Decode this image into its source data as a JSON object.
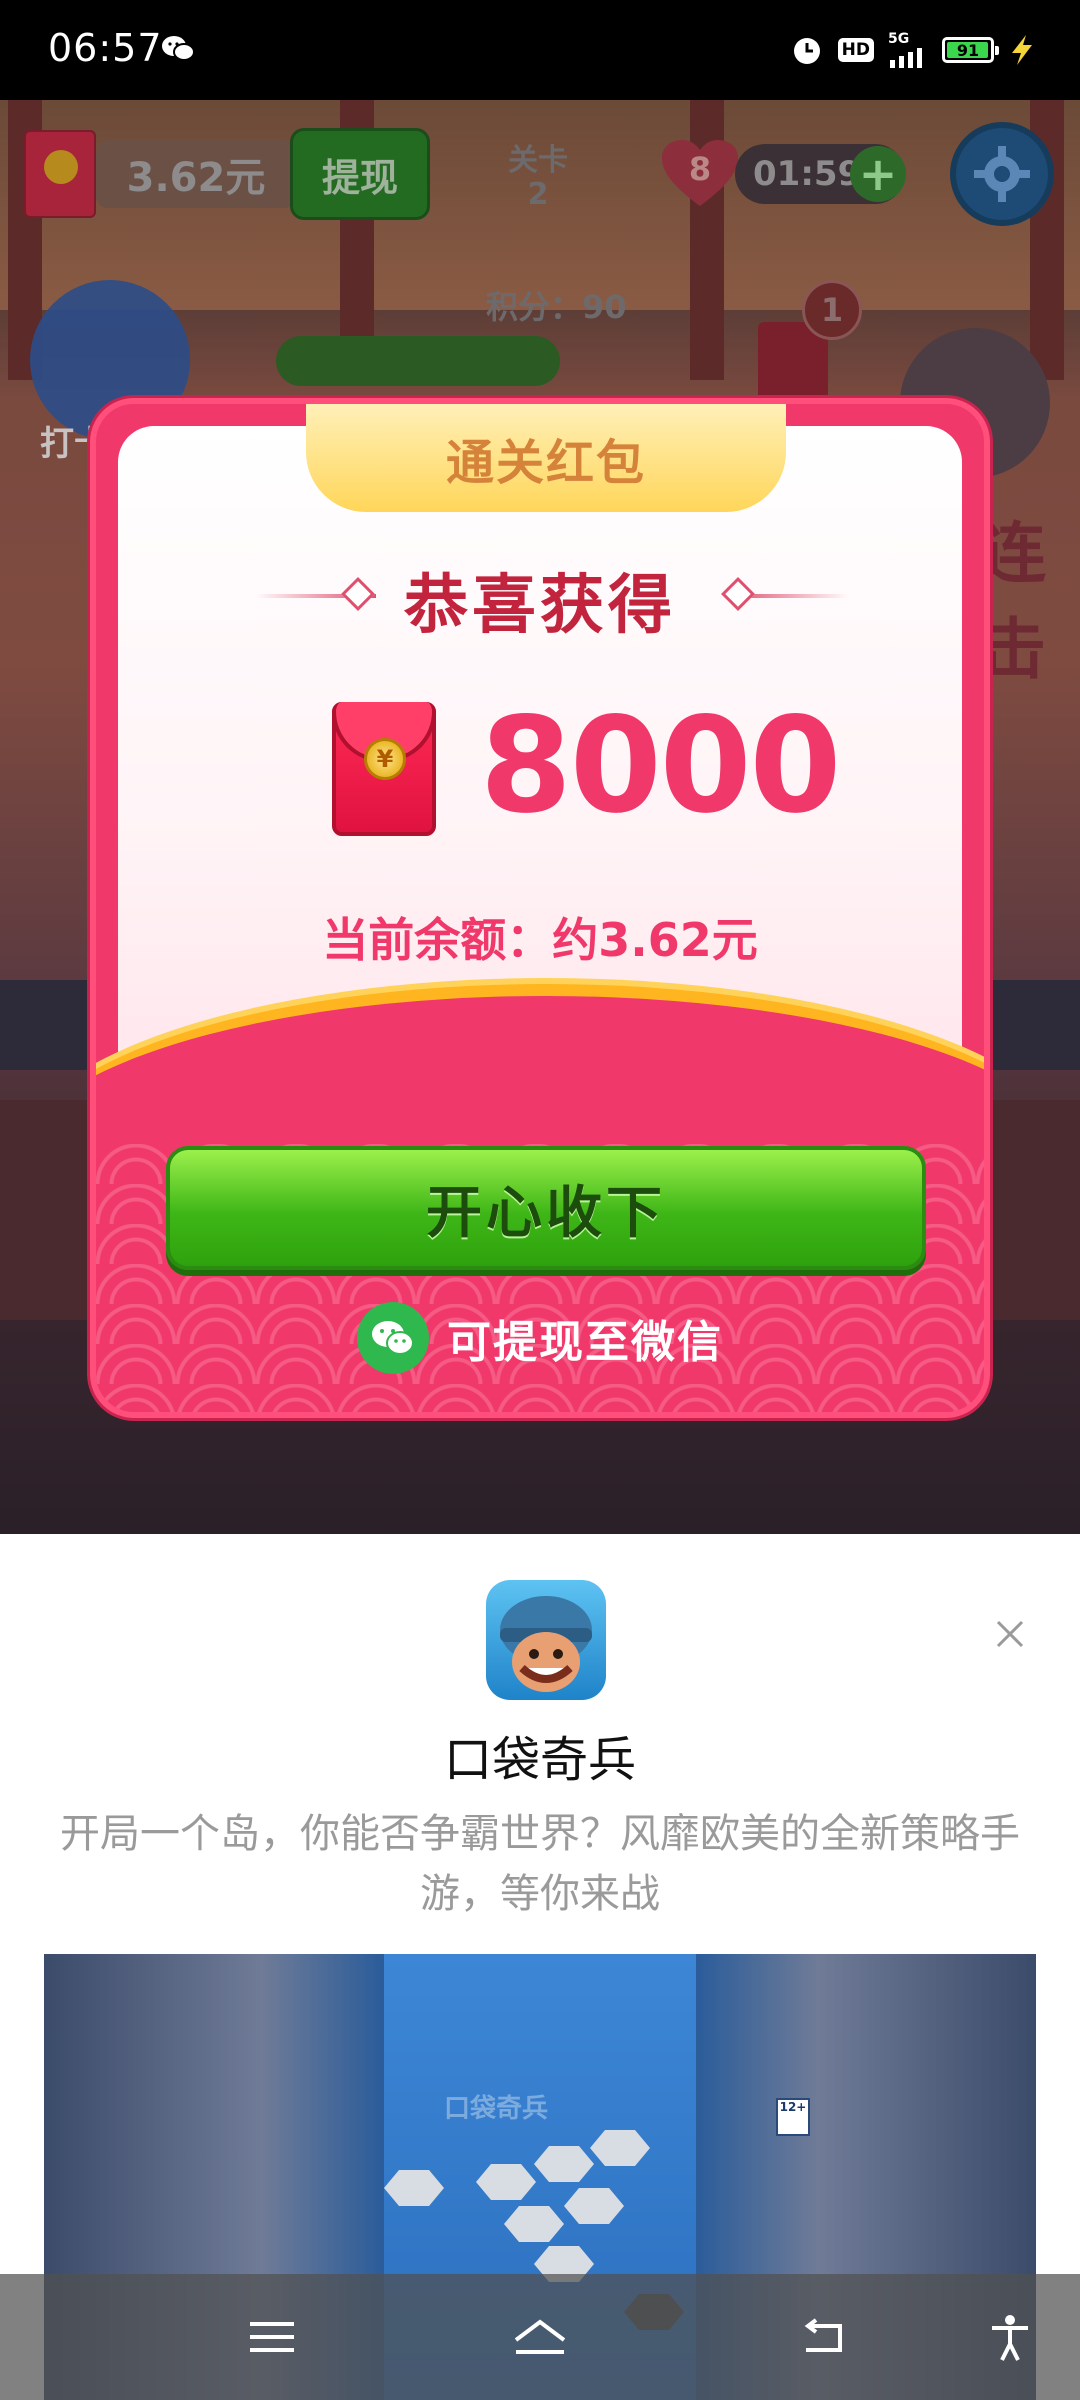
{
  "status_bar": {
    "time": "06:57",
    "network": "5G",
    "hd_label": "HD",
    "battery": "91"
  },
  "game_hud": {
    "balance": "3.62元",
    "withdraw_label": "提现",
    "level_label": "关卡",
    "level_number": "2",
    "lives": "8",
    "timer": "01:59",
    "score_label": "积分：90",
    "checkin_label": "打卡",
    "badge_count": "1",
    "side_text": "连击"
  },
  "reward_dialog": {
    "ribbon_title": "通关红包",
    "headline": "恭喜获得",
    "amount": "8000",
    "balance_line": "当前余额：约3.62元",
    "accept_button": "开心收下",
    "wechat_text": "可提现至微信",
    "coin_symbol": "¥"
  },
  "ad_sheet": {
    "app_name": "口袋奇兵",
    "description": "开局一个岛，你能否争霸世界？风靡欧美的全新策略手游，等你来战",
    "rating_badge": "12+",
    "media_logo_text": "口袋奇兵"
  },
  "colors": {
    "accent_pink": "#f0386a",
    "gold": "#ffb51f",
    "green": "#3eb617",
    "wechat_green": "#2fb84d"
  },
  "icons": {
    "close": "close-icon",
    "settings": "gear-icon",
    "heart": "heart-icon",
    "wechat": "wechat-icon",
    "red_envelope": "red-envelope-icon"
  }
}
